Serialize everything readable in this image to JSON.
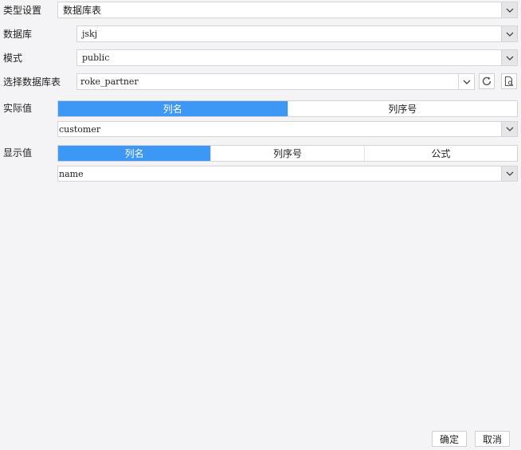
{
  "form": {
    "type_setting": {
      "label": "类型设置",
      "value": "数据库表"
    },
    "database": {
      "label": "数据库",
      "value": "jskj"
    },
    "schema": {
      "label": "模式",
      "value": "public"
    },
    "table": {
      "label": "选择数据库表",
      "value": "roke_partner"
    },
    "actual_value": {
      "label": "实际值",
      "tabs": [
        "列名",
        "列序号"
      ],
      "active_tab": 0,
      "column": "customer"
    },
    "display_value": {
      "label": "显示值",
      "tabs": [
        "列名",
        "列序号",
        "公式"
      ],
      "active_tab": 0,
      "column": "name"
    }
  },
  "footer": {
    "ok_label": "确定",
    "cancel_label": "取消"
  },
  "icons": {
    "dropdown": "chevron-down-icon",
    "refresh": "refresh-icon",
    "preview": "preview-icon"
  },
  "colors": {
    "accent": "#3d97f5"
  }
}
